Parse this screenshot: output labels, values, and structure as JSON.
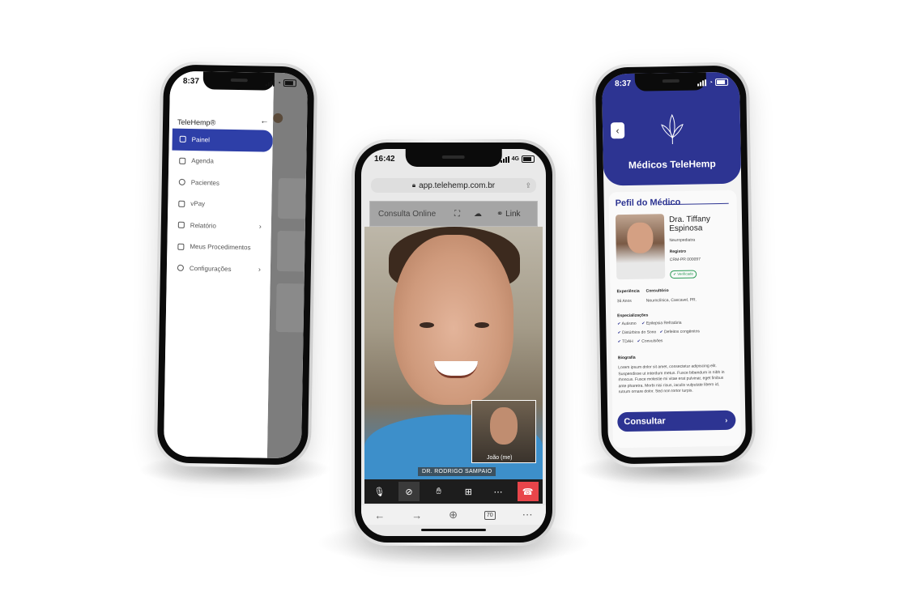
{
  "phone_left": {
    "time": "8:37",
    "brand": "TeleHemp®",
    "menu": [
      {
        "label": "Painel",
        "icon": "grid-icon",
        "active": true
      },
      {
        "label": "Agenda",
        "icon": "calendar-icon"
      },
      {
        "label": "Pacientes",
        "icon": "users-icon"
      },
      {
        "label": "vPay",
        "icon": "wallet-icon"
      },
      {
        "label": "Relatório",
        "icon": "report-icon",
        "chevron": "›"
      },
      {
        "label": "Meus Procedimentos",
        "icon": "procedures-icon"
      },
      {
        "label": "Configurações",
        "icon": "gear-icon",
        "chevron": "›"
      }
    ]
  },
  "phone_center": {
    "time": "16:42",
    "network": "4G",
    "url": "app.telehemp.com.br",
    "call_title": "Consulta Online",
    "link_label": "Link",
    "remote_name": "DR. RODRIGO SAMPAIO",
    "self_label": "João (me)",
    "tabs_count": "70"
  },
  "phone_right": {
    "time": "8:37",
    "header_title": "Médicos TeleHemp",
    "section_title": "Pefil do Médico",
    "doctor_name": "Dra. Tiffany Espinosa",
    "specialty": "Neuropediatra",
    "registry_label": "Registro",
    "registry_value": "CRM-PR 000097",
    "verified": "Verificado",
    "experience_label": "Experiência",
    "experience_value": "36 Anos",
    "office_label": "Consultório",
    "office_value": "Neuroclínica, Cascavel, PR.",
    "specializations_label": "Especializações",
    "specializations": [
      "Autismo",
      "Epilepsia Refratária",
      "Distúrbios do Sono",
      "Defeitos congênitos",
      "TDAH",
      "Convulsões"
    ],
    "bio_label": "Biografia",
    "bio_text": "Lorem ipsum dolor sit amet, consectetur adipiscing elit. Suspendisse ut interdum metus. Fusce bibendum in nibh in rhoncus. Fusce molestie mi vitae erat pulvinar, eget finibus ante pharetra. Morbi nisi risus, iaculis vulputate libero id, rutrum ornare dolor. Sed non tortor turpis.",
    "cta_label": "Consultar",
    "cta_arrow": "›"
  },
  "colors": {
    "brand_blue": "#2d3492",
    "active_nav": "#2e3fa8",
    "end_call": "#e8454a"
  }
}
